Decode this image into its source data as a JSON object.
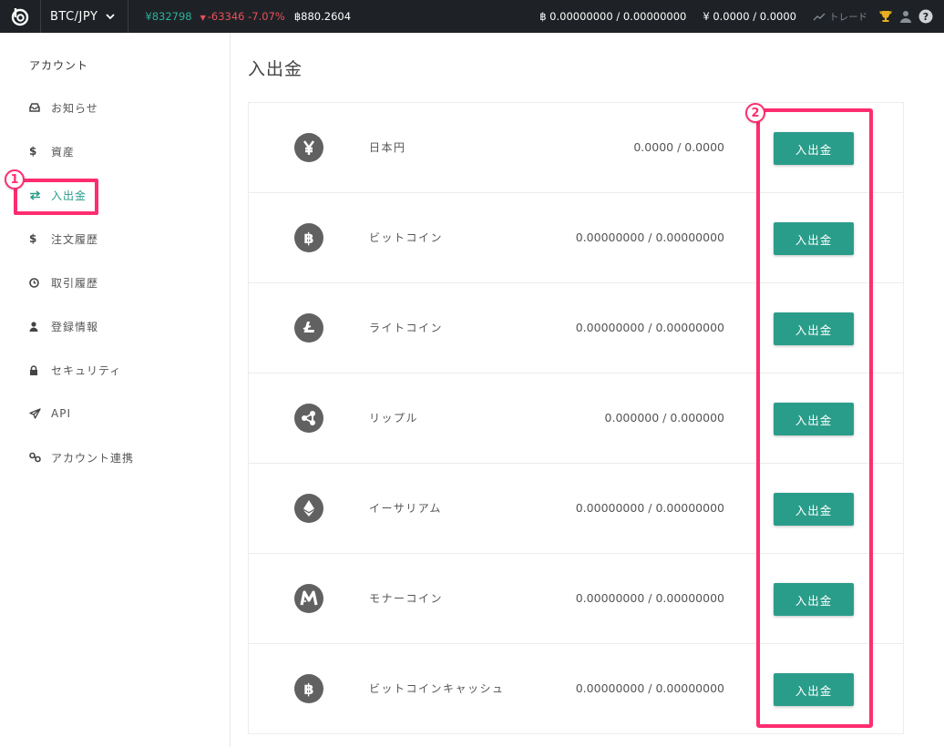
{
  "header": {
    "pair": "BTC/JPY",
    "price": "¥832798",
    "change": "-63346 -7.07%",
    "btc_price": "฿880.2604",
    "btc_balance": "฿ 0.00000000 / 0.00000000",
    "jpy_balance": "¥ 0.0000 / 0.0000",
    "trade_label": "トレード"
  },
  "sidebar": {
    "title": "アカウント",
    "items": [
      {
        "label": "お知らせ",
        "icon": "inbox-icon"
      },
      {
        "label": "資産",
        "icon": "dollar-icon"
      },
      {
        "label": "入出金",
        "icon": "exchange-arrows-icon"
      },
      {
        "label": "注文履歴",
        "icon": "dollar-icon"
      },
      {
        "label": "取引履歴",
        "icon": "clock-icon"
      },
      {
        "label": "登録情報",
        "icon": "user-icon"
      },
      {
        "label": "セキュリティ",
        "icon": "lock-icon"
      },
      {
        "label": "API",
        "icon": "paper-plane-icon"
      },
      {
        "label": "アカウント連携",
        "icon": "link-icon"
      }
    ]
  },
  "annotations": {
    "badge1": "1",
    "badge2": "2",
    "color": "#ff2d6f"
  },
  "main": {
    "title": "入出金",
    "button_label": "入出金",
    "accent": "#2a9d8a",
    "rows": [
      {
        "name": "日本円",
        "balance": "0.0000 / 0.0000",
        "icon": "yen-icon"
      },
      {
        "name": "ビットコイン",
        "balance": "0.00000000 / 0.00000000",
        "icon": "bitcoin-icon"
      },
      {
        "name": "ライトコイン",
        "balance": "0.00000000 / 0.00000000",
        "icon": "litecoin-icon"
      },
      {
        "name": "リップル",
        "balance": "0.000000 / 0.000000",
        "icon": "ripple-icon"
      },
      {
        "name": "イーサリアム",
        "balance": "0.00000000 / 0.00000000",
        "icon": "ethereum-icon"
      },
      {
        "name": "モナーコイン",
        "balance": "0.00000000 / 0.00000000",
        "icon": "monacoin-icon"
      },
      {
        "name": "ビットコインキャッシュ",
        "balance": "0.00000000 / 0.00000000",
        "icon": "bitcoin-cash-icon"
      }
    ]
  }
}
